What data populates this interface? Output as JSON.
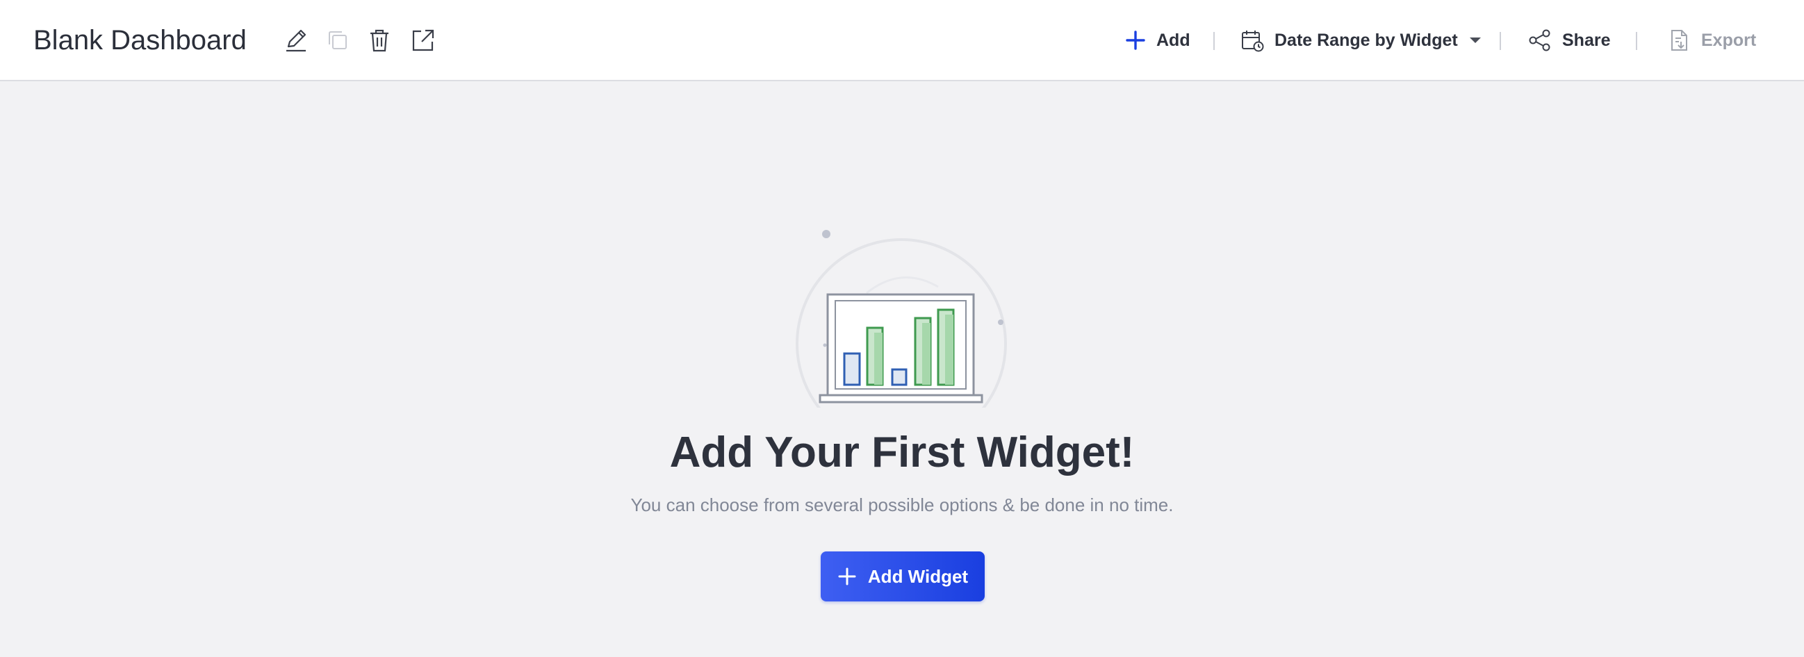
{
  "header": {
    "title": "Blank Dashboard",
    "actions": {
      "add_label": "Add",
      "date_range_label": "Date Range by Widget",
      "share_label": "Share",
      "export_label": "Export"
    }
  },
  "empty_state": {
    "heading": "Add Your First Widget!",
    "subtext": "You can choose from several possible options & be done in no time.",
    "button_label": "Add Widget"
  },
  "colors": {
    "accent": "#1a3fe0",
    "chart_green": "#3f9a4f",
    "chart_blue": "#2f5fb3",
    "background": "#f2f2f4"
  }
}
